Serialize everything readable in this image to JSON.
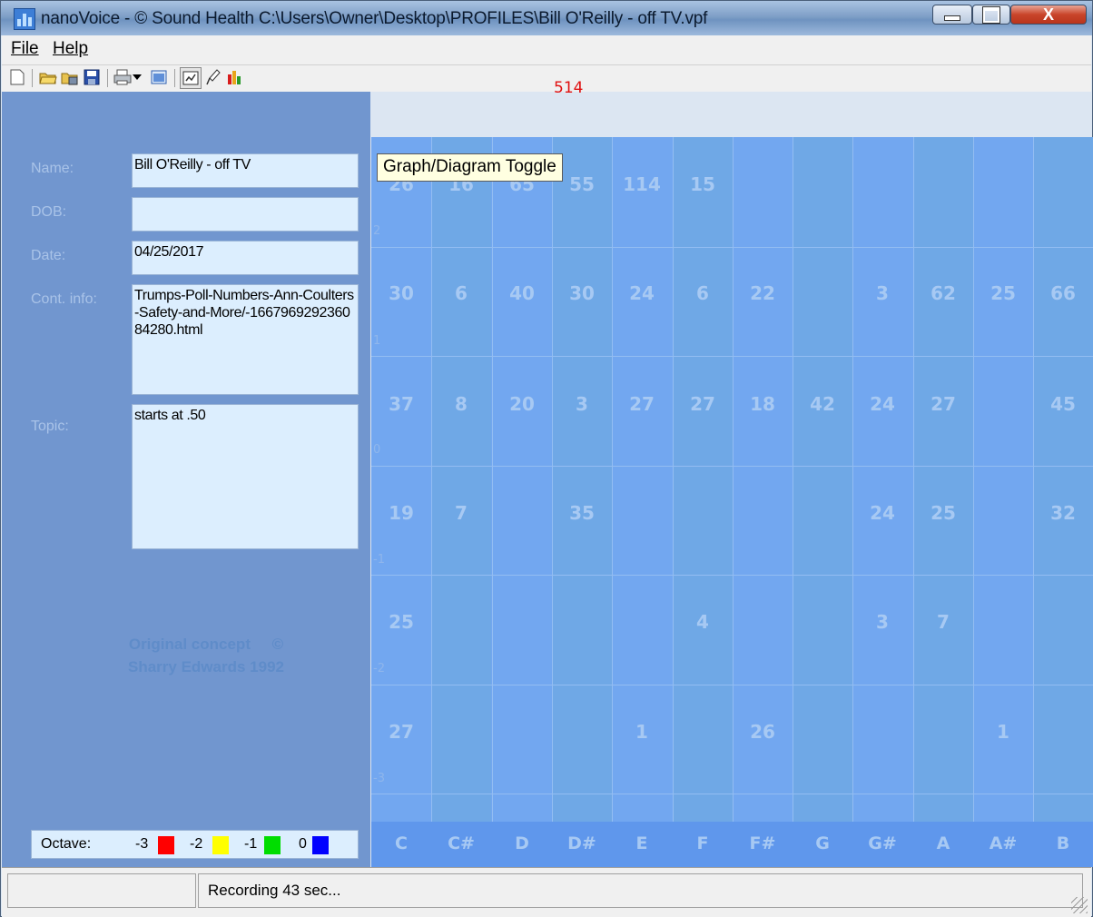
{
  "window": {
    "title": "nanoVoice - © Sound Health C:\\Users\\Owner\\Desktop\\PROFILES\\Bill O'Reilly - off TV.vpf"
  },
  "menu": {
    "file": "File",
    "help": "Help"
  },
  "toolbar": {
    "icons": [
      "new-file-icon",
      "open-folder-icon",
      "open-archive-icon",
      "save-icon",
      "print-icon",
      "dropdown-arrow-icon",
      "window-icon",
      "graph-diagram-toggle-icon",
      "microphone-icon",
      "bar-chart-icon"
    ],
    "counter": "514",
    "tooltip": "Graph/Diagram Toggle"
  },
  "form": {
    "name_label": "Name:",
    "name_value": "Bill O'Reilly - off TV",
    "dob_label": "DOB:",
    "dob_value": "",
    "date_label": "Date:",
    "date_value": "04/25/2017",
    "contact_label": "Cont. info:",
    "contact_value": "Trumps-Poll-Numbers-Ann-Coulters-Safety-and-More/-166796929236084280.html",
    "topic_label": "Topic:",
    "topic_value": "starts at .50"
  },
  "credit": {
    "line1": "Original concept",
    "copyright": "©",
    "line2": "Sharry Edwards 1992"
  },
  "legend": {
    "label": "Octave:",
    "items": [
      {
        "label": "-3",
        "color": "#ff0000"
      },
      {
        "label": "-2",
        "color": "#ffff00"
      },
      {
        "label": "-1",
        "color": "#00dd00"
      },
      {
        "label": "0",
        "color": "#0000ff"
      }
    ]
  },
  "grid": {
    "notes": [
      "C",
      "C#",
      "D",
      "D#",
      "E",
      "F",
      "F#",
      "G",
      "G#",
      "A",
      "A#",
      "B"
    ],
    "rows": [
      {
        "octave": "2",
        "values": [
          "26",
          "16",
          "65",
          "55",
          "114",
          "15",
          "",
          "",
          "",
          "",
          "",
          ""
        ]
      },
      {
        "octave": "1",
        "values": [
          "30",
          "6",
          "40",
          "30",
          "24",
          "6",
          "22",
          "",
          "3",
          "62",
          "25",
          "66"
        ]
      },
      {
        "octave": "0",
        "values": [
          "37",
          "8",
          "20",
          "3",
          "27",
          "27",
          "18",
          "42",
          "24",
          "27",
          "",
          "45"
        ]
      },
      {
        "octave": "-1",
        "values": [
          "19",
          "7",
          "",
          "35",
          "",
          "",
          "",
          "",
          "24",
          "25",
          "",
          "32"
        ]
      },
      {
        "octave": "-2",
        "values": [
          "25",
          "",
          "",
          "",
          "",
          "4",
          "",
          "",
          "3",
          "7",
          "",
          ""
        ]
      },
      {
        "octave": "-3",
        "values": [
          "27",
          "",
          "",
          "",
          "1",
          "",
          "26",
          "",
          "",
          "",
          "1",
          ""
        ]
      }
    ]
  },
  "status": {
    "panel1": "",
    "panel2": "Recording 43 sec..."
  }
}
